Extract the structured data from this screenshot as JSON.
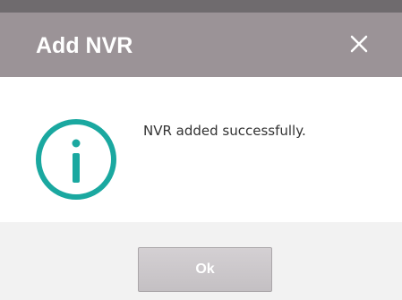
{
  "dialog": {
    "title": "Add NVR",
    "close_icon": "close-icon",
    "status_icon": "info-icon",
    "message": "NVR added successfully.",
    "ok_label": "Ok"
  },
  "colors": {
    "title_bar": "#9b9397",
    "top_strip": "#6f6b6e",
    "info_icon": "#1aa8a0",
    "footer": "#f2f2f2",
    "ok_button": "#c8c4c7"
  }
}
